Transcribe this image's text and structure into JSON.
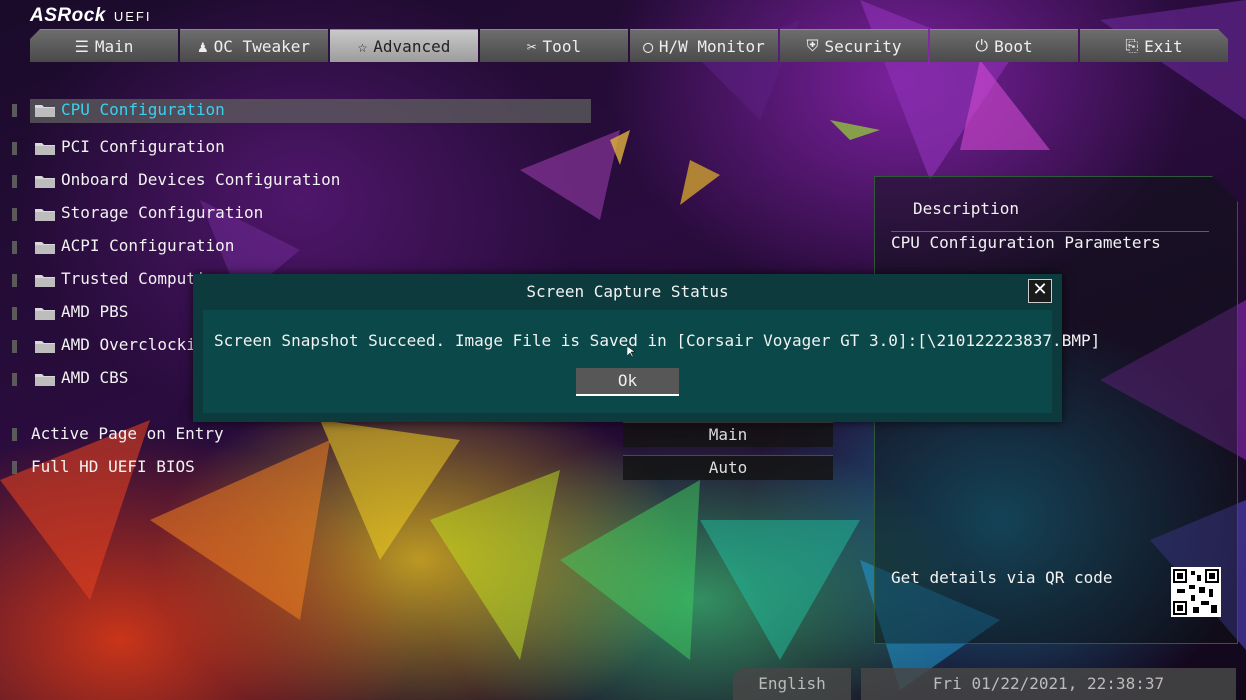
{
  "brand": {
    "name": "ASRock",
    "product": "UEFI"
  },
  "tabs": [
    {
      "label": "Main",
      "icon": "list-icon",
      "glyph": "☰"
    },
    {
      "label": "OC Tweaker",
      "icon": "rocket-icon",
      "glyph": "♟"
    },
    {
      "label": "Advanced",
      "icon": "star-icon",
      "glyph": "☆"
    },
    {
      "label": "Tool",
      "icon": "tools-icon",
      "glyph": "✂"
    },
    {
      "label": "H/W Monitor",
      "icon": "monitor-icon",
      "glyph": "◯"
    },
    {
      "label": "Security",
      "icon": "shield-icon",
      "glyph": "⛨"
    },
    {
      "label": "Boot",
      "icon": "power-icon",
      "glyph": "⏻"
    },
    {
      "label": "Exit",
      "icon": "exit-icon",
      "glyph": "⎘"
    }
  ],
  "active_tab": "Advanced",
  "menu": {
    "items": [
      {
        "label": "CPU Configuration"
      },
      {
        "label": "PCI Configuration"
      },
      {
        "label": "Onboard Devices Configuration"
      },
      {
        "label": "Storage Configuration"
      },
      {
        "label": "ACPI Configuration"
      },
      {
        "label": "Trusted Computing"
      },
      {
        "label": "AMD PBS"
      },
      {
        "label": "AMD Overclocking"
      },
      {
        "label": "AMD CBS"
      }
    ],
    "selected": "CPU Configuration"
  },
  "settings": [
    {
      "label": "Active Page on Entry",
      "value": "Main"
    },
    {
      "label": "Full HD UEFI BIOS",
      "value": "Auto"
    }
  ],
  "description": {
    "title": "Description",
    "text": "CPU Configuration Parameters",
    "qr_label": "Get details via QR code"
  },
  "dialog": {
    "title": "Screen Capture Status",
    "close_glyph": "✕",
    "message": "Screen Snapshot Succeed. Image File is Saved in  [Corsair Voyager GT 3.0]:[\\210122223837.BMP]",
    "ok_label": "Ok"
  },
  "status": {
    "language": "English",
    "datetime": "Fri 01/22/2021, 22:38:37"
  },
  "colors": {
    "selected_text": "#3ad0f0",
    "dialog_bg": "#0c3a3d",
    "tab_active": "#b5b5b5"
  }
}
